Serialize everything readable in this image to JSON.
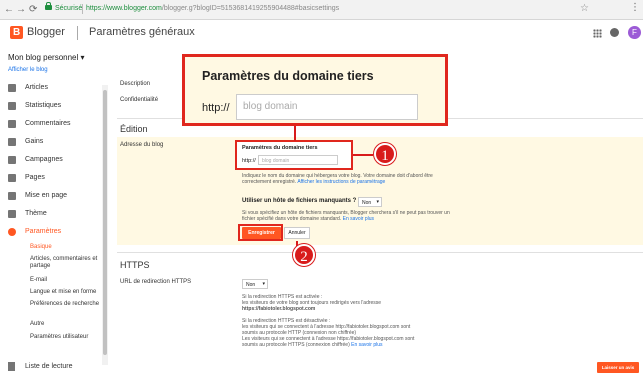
{
  "browser": {
    "back": "←",
    "forward": "→",
    "reload": "⟳",
    "secure_label": "Sécurisé",
    "url_host": "https://www.blogger.com",
    "url_path": "/blogger.g?blogID=5153681419255904488#basicsettings"
  },
  "header": {
    "brand": "Blogger",
    "title": "Paramètres généraux",
    "avatar_letter": "F"
  },
  "blog": {
    "name": "Mon blog personnel ▾",
    "view_link": "Afficher le blog"
  },
  "sidebar": {
    "items": [
      {
        "label": "Articles",
        "icon": "articles-icon"
      },
      {
        "label": "Statistiques",
        "icon": "stats-icon"
      },
      {
        "label": "Commentaires",
        "icon": "comments-icon"
      },
      {
        "label": "Gains",
        "icon": "earnings-icon"
      },
      {
        "label": "Campagnes",
        "icon": "campaigns-icon"
      },
      {
        "label": "Pages",
        "icon": "pages-icon"
      },
      {
        "label": "Mise en page",
        "icon": "layout-icon"
      },
      {
        "label": "Thème",
        "icon": "theme-icon"
      },
      {
        "label": "Paramètres",
        "icon": "settings-icon"
      }
    ],
    "sub_items": [
      "Basique",
      "Articles, commentaires et partage",
      "E-mail",
      "Langue et mise en forme",
      "Préférences de recherche",
      "Autre",
      "Paramètres utilisateur"
    ],
    "reading_list": "Liste de lecture"
  },
  "main": {
    "description_label": "Description",
    "privacy_label": "Confidentialité",
    "edition_title": "Édition",
    "blog_address_label": "Adresse du blog",
    "third_party": {
      "title": "Paramètres du domaine tiers",
      "prefix": "http://",
      "placeholder": "blog domain"
    },
    "help1_text": "Indiquez le nom du domaine qui hébergera votre blog. Votre domaine doit d'abord être correctement enregistré.",
    "help1_link": "Afficher les instructions de paramétrage",
    "missing_files_label": "Utiliser un hôte de fichiers manquants ?",
    "missing_files_value": "Non",
    "help2_text": "Si vous spécifiez un hôte de fichiers manquants, Blogger cherchera s'il ne peut pas trouver un fichier spécifié dans votre domaine standard.",
    "help2_link": "En savoir plus",
    "save_label": "Enregistrer",
    "cancel_label": "Annuler",
    "https_title": "HTTPS",
    "https_redirect_label": "URL de redirection HTTPS",
    "https_value": "Non",
    "https_help_on_1": "Si la redirection HTTPS est activée :",
    "https_help_on_2": "les visiteurs de votre blog sont toujours redirigés vers l'adresse",
    "https_help_on_3": "https://fabiotoler.blogspot.com",
    "https_help_off_1": "Si la redirection HTTPS est désactivée :",
    "https_help_off_2": "les visiteurs qui se connectent à l'adresse http://fabiotoler.blogspot.com sont",
    "https_help_off_3": "soumis au protocole HTTP (connexion non chiffrée)",
    "https_help_off_4": "Les visiteurs qui se connectent à l'adresse https://fabiotoler.blogspot.com sont",
    "https_help_off_5": "soumis au protocole HTTPS (connexion chiffrée)",
    "https_help_link": "En savoir plus",
    "leave_label": "Laisser un avis"
  },
  "annotations": {
    "badge1": "1",
    "badge2": "2",
    "color": "#d81b1b"
  },
  "colors": {
    "accent": "#ff5722",
    "highlight": "#fff9e3",
    "callout_border": "#e0271d",
    "link": "#1a73e8"
  }
}
